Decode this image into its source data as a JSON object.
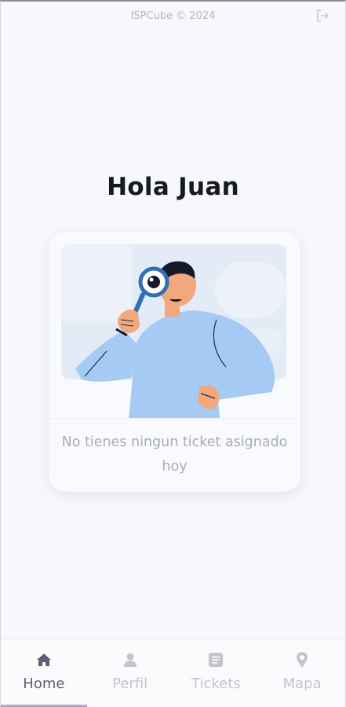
{
  "header": {
    "copyright": "ISPCube © 2024",
    "logout_icon": "logout-icon"
  },
  "greeting": "Hola Juan",
  "empty_state": {
    "illustration": "person-with-magnifying-glass",
    "message": "No tienes ningun ticket asignado hoy"
  },
  "bottom_nav": {
    "active": "Home",
    "items": [
      {
        "label": "Home",
        "icon": "home-icon"
      },
      {
        "label": "Perfil",
        "icon": "user-icon"
      },
      {
        "label": "Tickets",
        "icon": "ticket-icon"
      },
      {
        "label": "Mapa",
        "icon": "map-pin-icon"
      }
    ]
  },
  "colors": {
    "background": "#f7f8fd",
    "active_nav": "#5d6072",
    "inactive_nav": "#c2c5ce",
    "illustration_shirt": "#a5cbf4",
    "lens_rim": "#2e6fb5"
  }
}
